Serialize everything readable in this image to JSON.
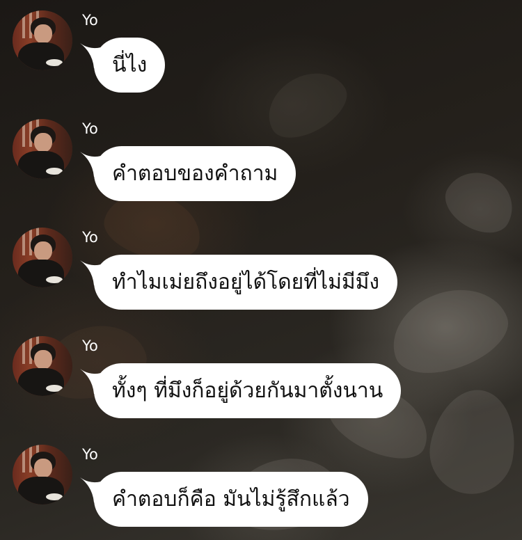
{
  "messages": [
    {
      "sender": "Yo",
      "text": "นี่ไง"
    },
    {
      "sender": "Yo",
      "text": "คำตอบของคำถาม"
    },
    {
      "sender": "Yo",
      "text": "ทำไมเม่ยถึงอยู่ได้โดยที่ไม่มีมึง"
    },
    {
      "sender": "Yo",
      "text": "ทั้งๆ ที่มึงก็อยู่ด้วยกันมาตั้งนาน"
    },
    {
      "sender": "Yo",
      "text": "คำตอบก็คือ มันไม่รู้สึกแล้ว"
    }
  ],
  "colors": {
    "bubble": "#ffffff",
    "bubble_text": "#111111",
    "sender_text": "#ffffff"
  },
  "icons": {
    "avatar": "profile-photo"
  }
}
